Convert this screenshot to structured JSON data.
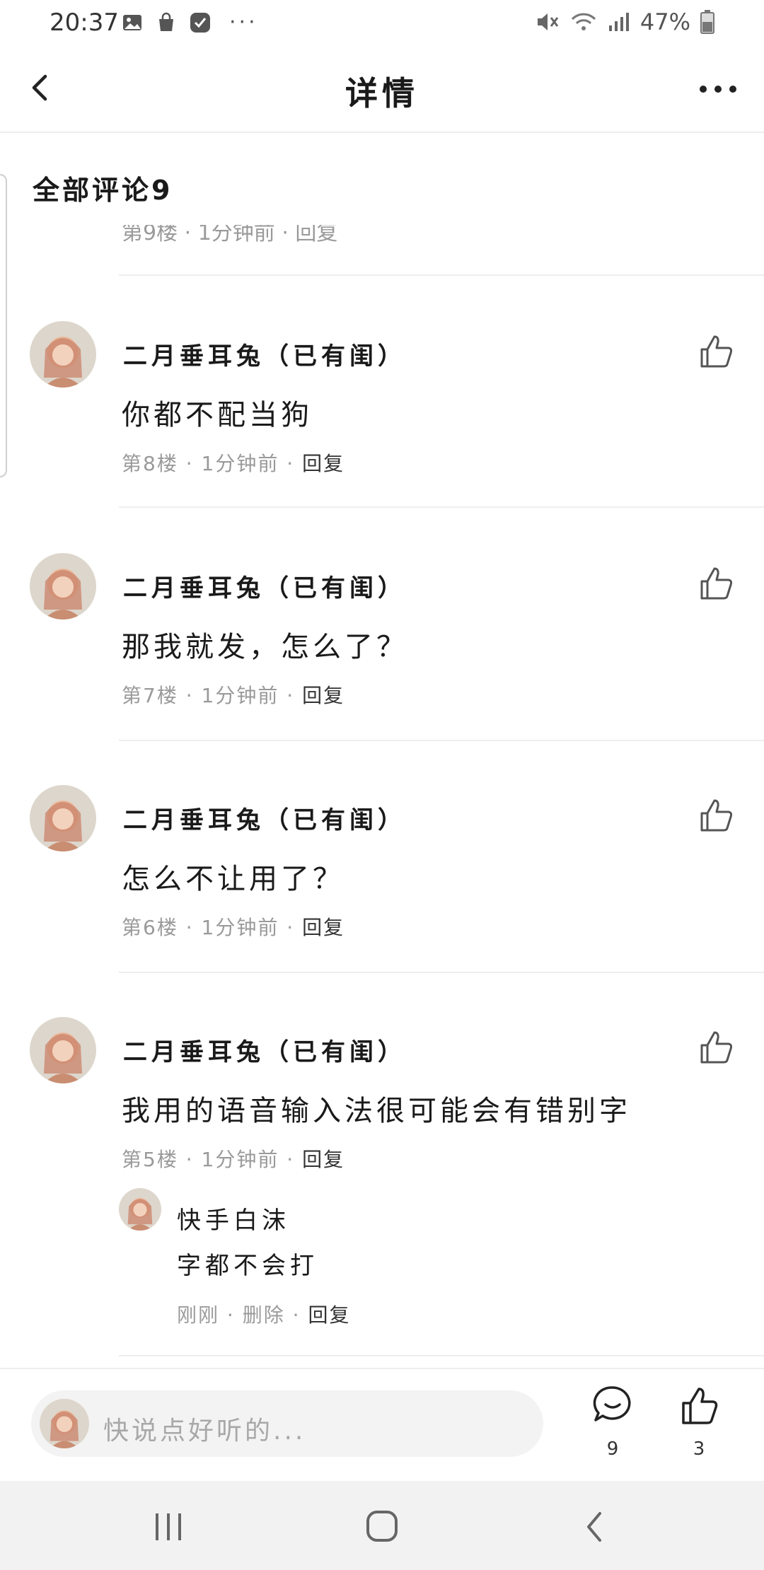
{
  "status_bar": {
    "time": "20:37",
    "battery": "47%",
    "icons_left": [
      "image-icon",
      "bag-icon",
      "check-app-icon",
      "more-dots-icon"
    ],
    "icons_right": [
      "mute-icon",
      "wifi-icon",
      "signal-icon",
      "battery-icon"
    ]
  },
  "header": {
    "title": "详情"
  },
  "comments_section": {
    "title": "全部评论9",
    "partial_meta": "第9楼 · 1分钟前 · 回复"
  },
  "comments": [
    {
      "name": "二月垂耳兔（已有闺）",
      "text": "你都不配当狗",
      "floor": "第8楼",
      "time": "1分钟前",
      "reply": "回复"
    },
    {
      "name": "二月垂耳兔（已有闺）",
      "text": "那我就发，怎么了？",
      "floor": "第7楼",
      "time": "1分钟前",
      "reply": "回复"
    },
    {
      "name": "二月垂耳兔（已有闺）",
      "text": "怎么不让用了？",
      "floor": "第6楼",
      "time": "1分钟前",
      "reply": "回复"
    },
    {
      "name": "二月垂耳兔（已有闺）",
      "text": "我用的语音输入法很可能会有错别字",
      "floor": "第5楼",
      "time": "1分钟前",
      "reply": "回复"
    }
  ],
  "sub_reply": {
    "name": "快手白沫",
    "text": "字都不会打",
    "time": "刚刚",
    "delete": "删除",
    "reply": "回复"
  },
  "meta_separator": " · ",
  "bottom_bar": {
    "placeholder": "快说点好听的...",
    "comment_count": "9",
    "like_count": "3"
  },
  "colors": {
    "text": "#1a1a1a",
    "meta": "#9a9a9a",
    "divider": "#eeeeee",
    "input_bg": "#f3f3f3",
    "navbar_bg": "#f2f2f2"
  }
}
